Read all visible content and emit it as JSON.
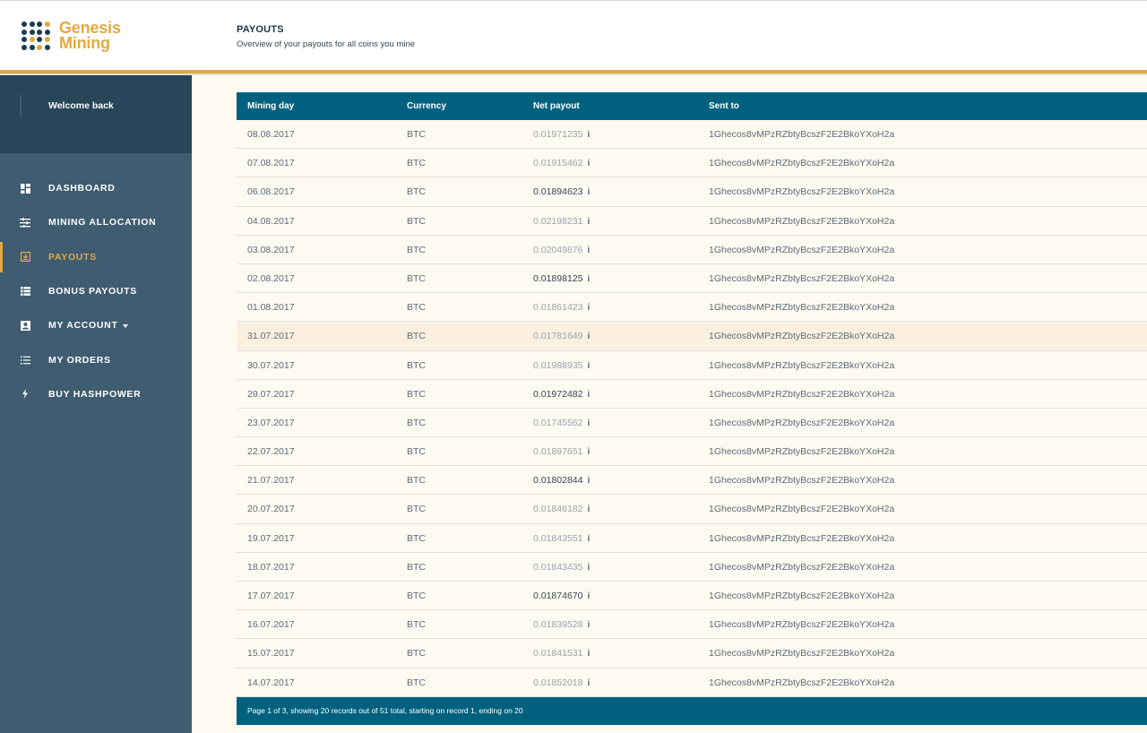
{
  "brand": {
    "line1": "Genesis",
    "line2": "Mining"
  },
  "header": {
    "title": "PAYOUTS",
    "subtitle": "Overview of your payouts for all coins you mine"
  },
  "sidebar": {
    "welcome": "Welcome back",
    "items": [
      {
        "label": "DASHBOARD",
        "icon": "dashboard-icon",
        "active": false
      },
      {
        "label": "MINING ALLOCATION",
        "icon": "sliders-icon",
        "active": false
      },
      {
        "label": "PAYOUTS",
        "icon": "download-icon",
        "active": true
      },
      {
        "label": "BONUS PAYOUTS",
        "icon": "list-icon",
        "active": false
      },
      {
        "label": "MY ACCOUNT",
        "icon": "account-icon",
        "active": false
      },
      {
        "label": "MY ORDERS",
        "icon": "orders-icon",
        "active": false
      },
      {
        "label": "BUY HASHPOWER",
        "icon": "bolt-icon",
        "active": false
      }
    ]
  },
  "table": {
    "columns": [
      "Mining day",
      "Currency",
      "Net payout",
      "Sent to"
    ],
    "rows": [
      {
        "day": "08.08.2017",
        "currency": "BTC",
        "payout": "0.01971235",
        "sent_to": "1Ghecos8vMPzRZbtyBcszF2E2BkoYXoH2a"
      },
      {
        "day": "07.08.2017",
        "currency": "BTC",
        "payout": "0.01915462",
        "sent_to": "1Ghecos8vMPzRZbtyBcszF2E2BkoYXoH2a"
      },
      {
        "day": "06.08.2017",
        "currency": "BTC",
        "payout": "0.01894623",
        "sent_to": "1Ghecos8vMPzRZbtyBcszF2E2BkoYXoH2a"
      },
      {
        "day": "04.08.2017",
        "currency": "BTC",
        "payout": "0.02198231",
        "sent_to": "1Ghecos8vMPzRZbtyBcszF2E2BkoYXoH2a"
      },
      {
        "day": "03.08.2017",
        "currency": "BTC",
        "payout": "0.02049876",
        "sent_to": "1Ghecos8vMPzRZbtyBcszF2E2BkoYXoH2a"
      },
      {
        "day": "02.08.2017",
        "currency": "BTC",
        "payout": "0.01898125",
        "sent_to": "1Ghecos8vMPzRZbtyBcszF2E2BkoYXoH2a"
      },
      {
        "day": "01.08.2017",
        "currency": "BTC",
        "payout": "0.01861423",
        "sent_to": "1Ghecos8vMPzRZbtyBcszF2E2BkoYXoH2a"
      },
      {
        "day": "31.07.2017",
        "currency": "BTC",
        "payout": "0.01781649",
        "sent_to": "1Ghecos8vMPzRZbtyBcszF2E2BkoYXoH2a"
      },
      {
        "day": "30.07.2017",
        "currency": "BTC",
        "payout": "0.01988935",
        "sent_to": "1Ghecos8vMPzRZbtyBcszF2E2BkoYXoH2a"
      },
      {
        "day": "29.07.2017",
        "currency": "BTC",
        "payout": "0.01972482",
        "sent_to": "1Ghecos8vMPzRZbtyBcszF2E2BkoYXoH2a"
      },
      {
        "day": "23.07.2017",
        "currency": "BTC",
        "payout": "0.01745562",
        "sent_to": "1Ghecos8vMPzRZbtyBcszF2E2BkoYXoH2a"
      },
      {
        "day": "22.07.2017",
        "currency": "BTC",
        "payout": "0.01897651",
        "sent_to": "1Ghecos8vMPzRZbtyBcszF2E2BkoYXoH2a"
      },
      {
        "day": "21.07.2017",
        "currency": "BTC",
        "payout": "0.01802844",
        "sent_to": "1Ghecos8vMPzRZbtyBcszF2E2BkoYXoH2a"
      },
      {
        "day": "20.07.2017",
        "currency": "BTC",
        "payout": "0.01846182",
        "sent_to": "1Ghecos8vMPzRZbtyBcszF2E2BkoYXoH2a"
      },
      {
        "day": "19.07.2017",
        "currency": "BTC",
        "payout": "0.01843551",
        "sent_to": "1Ghecos8vMPzRZbtyBcszF2E2BkoYXoH2a"
      },
      {
        "day": "18.07.2017",
        "currency": "BTC",
        "payout": "0.01843435",
        "sent_to": "1Ghecos8vMPzRZbtyBcszF2E2BkoYXoH2a"
      },
      {
        "day": "17.07.2017",
        "currency": "BTC",
        "payout": "0.01874670",
        "sent_to": "1Ghecos8vMPzRZbtyBcszF2E2BkoYXoH2a"
      },
      {
        "day": "16.07.2017",
        "currency": "BTC",
        "payout": "0.01839528",
        "sent_to": "1Ghecos8vMPzRZbtyBcszF2E2BkoYXoH2a"
      },
      {
        "day": "15.07.2017",
        "currency": "BTC",
        "payout": "0.01841531",
        "sent_to": "1Ghecos8vMPzRZbtyBcszF2E2BkoYXoH2a"
      },
      {
        "day": "14.07.2017",
        "currency": "BTC",
        "payout": "0.01852018",
        "sent_to": "1Ghecos8vMPzRZbtyBcszF2E2BkoYXoH2a"
      }
    ],
    "info_symbol": "i",
    "footer": "Page 1 of 3, showing 20 records out of 51 total, starting on record 1, ending on 20"
  },
  "colors": {
    "accent": "#e4a93e",
    "table_header": "#00617f",
    "sidebar": "#3f5c70",
    "sidebar_top": "#28465a"
  }
}
